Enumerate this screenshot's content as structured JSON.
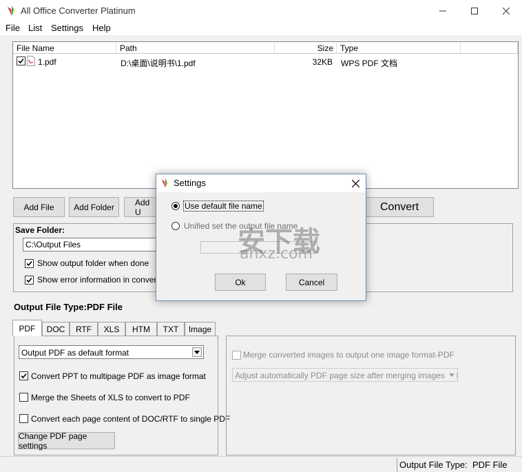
{
  "window": {
    "title": "All Office Converter Platinum"
  },
  "menu": [
    "File",
    "List",
    "Settings",
    "Help"
  ],
  "file_list": {
    "columns": [
      "File Name",
      "Path",
      "Size",
      "Type"
    ],
    "rows": [
      {
        "name": "1.pdf",
        "path": "D:\\桌面\\说明书\\1.pdf",
        "size": "32KB",
        "type": "WPS PDF 文档",
        "checked": true
      }
    ]
  },
  "toolbar": {
    "add_file": "Add File",
    "add_folder": "Add Folder",
    "add_url": "Add U",
    "convert": "Convert"
  },
  "save_folder": {
    "label": "Save Folder:",
    "path": "C:\\Output Files",
    "show_output": "Show output folder when done",
    "show_error": "Show error information in conversion"
  },
  "output_type": {
    "label": "Output File Type:",
    "value": "PDF File"
  },
  "tabs": [
    "PDF",
    "DOC",
    "RTF",
    "XLS",
    "HTM",
    "TXT",
    "Image"
  ],
  "pdf_options": {
    "format_select": "Output PDF as default format",
    "ppt_multipage": "Convert PPT to multipage PDF as image format",
    "merge_xls": "Merge the Sheets of XLS to convert to PDF",
    "each_page": "Convert each page content of DOC/RTF to single PDF",
    "page_settings": "Change PDF page settings"
  },
  "image_options": {
    "merge_images": "Merge converted images to output one image format-PDF",
    "adjust_select": "Adjust automatically PDF page size after merging images to PDF"
  },
  "dialog": {
    "title": "Settings",
    "opt_default": "Use default file name",
    "opt_unified": "Unified set the output file name",
    "ok": "Ok",
    "cancel": "Cancel"
  },
  "watermark": {
    "cn": "安下载",
    "en": "anxz.com"
  },
  "status": {
    "label": "Output File Type:",
    "value": "PDF File"
  }
}
